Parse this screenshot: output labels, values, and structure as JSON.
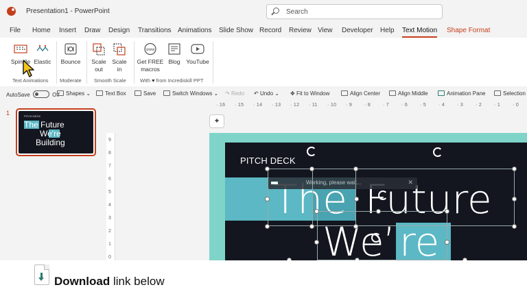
{
  "window": {
    "title": "Presentation1  -  PowerPoint",
    "search_placeholder": "Search"
  },
  "menu": {
    "tabs": [
      "File",
      "Home",
      "Insert",
      "Draw",
      "Design",
      "Transitions",
      "Animations",
      "Slide Show",
      "Record",
      "Review",
      "View",
      "Developer",
      "Help",
      "Text Motion",
      "Shape Format"
    ],
    "active": "Text Motion",
    "contextual": "Shape Format"
  },
  "ribbon": {
    "buttons": {
      "spindle": "Spindle",
      "elastic": "Elastic",
      "bounce": "Bounce",
      "scale_out": "Scale out",
      "scale_in": "Scale in",
      "get_free_macros": "Get FREE macros",
      "blog": "Blog",
      "youtube": "YouTube"
    },
    "groups": {
      "text_animations": "Text Animations",
      "moderate": "Moderate",
      "smooth_scale": "Smooth Scale",
      "with_from": "With",
      "from_text": "from Incrediskill PPT"
    }
  },
  "qat": {
    "autosave": "AutoSave",
    "autosave_state": "Off",
    "shapes": "Shapes",
    "text_box": "Text Box",
    "save": "Save",
    "switch_windows": "Switch Windows",
    "redo": "Redo",
    "undo": "Undo",
    "fit_to_window": "Fit to Window",
    "align_center": "Align Center",
    "align_middle": "Align Middle",
    "animation_pane": "Animation Pane",
    "selection_pane": "Selection P"
  },
  "slides_pane": {
    "number": "1",
    "thumb": {
      "pitch": "PITCH DECK",
      "line1": "The Future",
      "line2": "We're",
      "line3": "Building"
    }
  },
  "ruler": {
    "h_ticks": [
      "16",
      "15",
      "14",
      "13",
      "12",
      "11",
      "10",
      "9",
      "8",
      "7",
      "6",
      "5",
      "4",
      "3",
      "2",
      "1",
      "0"
    ],
    "v_ticks": [
      "9",
      "8",
      "7",
      "6",
      "5",
      "4",
      "3",
      "2",
      "1",
      "0"
    ]
  },
  "slide": {
    "pitch": "PITCH DECK",
    "line1_a": "The",
    "line1_b": "Future",
    "line2_a": "We",
    "line2_apos": "’",
    "line2_b": "re",
    "toast": "Working, please wait..."
  },
  "footer": {
    "bold": "Download",
    "rest": " link below"
  },
  "colors": {
    "accent": "#c43e1c",
    "teal": "#5bb8c4",
    "slide_dark": "#13161f",
    "slide_bg": "#7fd4c9"
  }
}
